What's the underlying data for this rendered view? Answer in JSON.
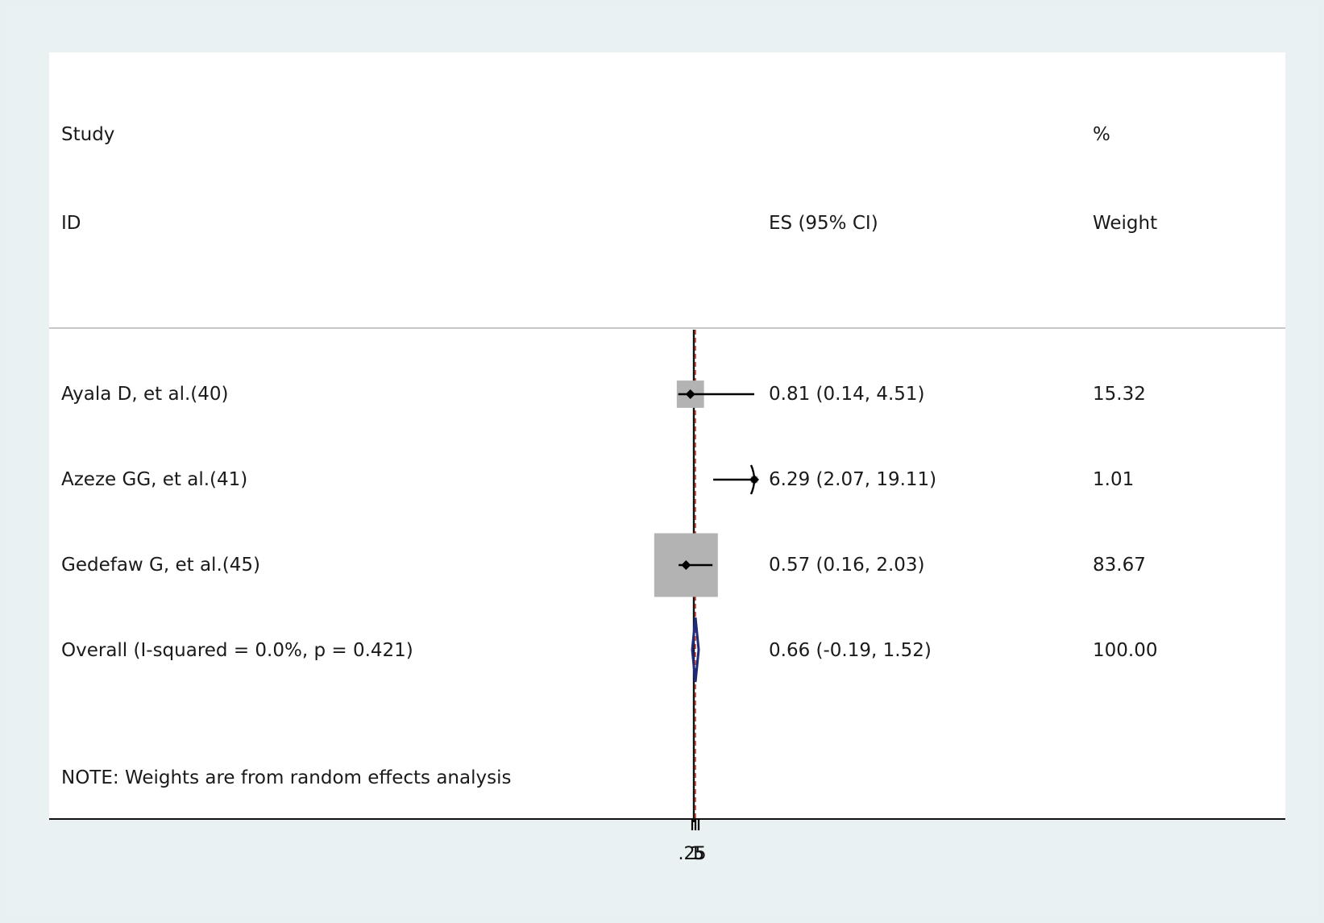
{
  "header": {
    "study_label": "Study",
    "id_label": "ID",
    "es_label": "ES (95% CI)",
    "pct_label": "%",
    "weight_label": "Weight"
  },
  "rows": [
    {
      "study": "Ayala D, et al.(40)",
      "es_ci": "0.81 (0.14, 4.51)",
      "weight": "15.32"
    },
    {
      "study": "Azeze GG, et al.(41)",
      "es_ci": "6.29 (2.07, 19.11)",
      "weight": "1.01"
    },
    {
      "study": "Gedefaw G, et al.(45)",
      "es_ci": "0.57 (0.16, 2.03)",
      "weight": "83.67"
    }
  ],
  "overall": {
    "label": "Overall  (I-squared = 0.0%, p = 0.421)",
    "es_ci": "0.66 (-0.19, 1.52)",
    "weight": "100.00"
  },
  "note": "NOTE: Weights are from random effects analysis",
  "colors": {
    "box": "#b3b3b3",
    "diamond": "#1f2a7a",
    "null_line": "#111111",
    "overall_line": "#c0392b"
  },
  "chart_data": {
    "type": "forest",
    "studies": [
      {
        "name": "Ayala D, et al.(40)",
        "es": 0.81,
        "lo": 0.14,
        "hi": 4.51,
        "weight": 15.32
      },
      {
        "name": "Azeze GG, et al.(41)",
        "es": 6.29,
        "lo": 2.07,
        "hi": 19.11,
        "weight": 1.01
      },
      {
        "name": "Gedefaw G, et al.(45)",
        "es": 0.57,
        "lo": 0.16,
        "hi": 2.03,
        "weight": 83.67
      }
    ],
    "overall": {
      "es": 0.66,
      "lo": -0.19,
      "hi": 1.52,
      "weight": 100.0
    },
    "null_value": 1,
    "x_tick_labels": [
      ".25",
      "1",
      "5"
    ]
  }
}
